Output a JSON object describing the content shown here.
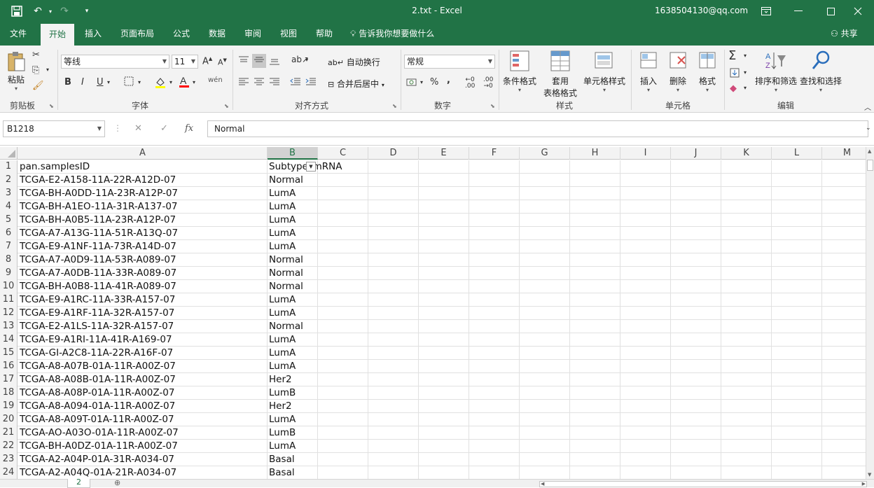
{
  "window": {
    "title": "2.txt  -  Excel",
    "user": "1638504130@qq.com"
  },
  "tabs": [
    "文件",
    "开始",
    "插入",
    "页面布局",
    "公式",
    "数据",
    "审阅",
    "视图",
    "帮助"
  ],
  "tellme": "告诉我你想要做什么",
  "share": "共享",
  "ribbon": {
    "clipboard": {
      "paste": "粘贴",
      "label": "剪贴板"
    },
    "font": {
      "name": "等线",
      "size": "11",
      "label": "字体",
      "bold": "B",
      "italic": "I",
      "underline": "U"
    },
    "alignment": {
      "wrap": "自动换行",
      "merge": "合并后居中",
      "label": "对齐方式"
    },
    "number": {
      "format": "常规",
      "label": "数字",
      "percent": "%",
      "comma": ","
    },
    "styles": {
      "conditional": "条件格式",
      "table_l1": "套用",
      "table_l2": "表格格式",
      "cell": "单元格样式",
      "label": "样式"
    },
    "cells": {
      "insert": "插入",
      "delete": "删除",
      "format": "格式",
      "label": "单元格"
    },
    "editing": {
      "sort": "排序和筛选",
      "find": "查找和选择",
      "label": "编辑"
    }
  },
  "formula_bar": {
    "name_box": "B1218",
    "value": "Normal"
  },
  "columns": [
    "A",
    "B",
    "C",
    "D",
    "E",
    "F",
    "G",
    "H",
    "I",
    "J",
    "K",
    "L",
    "M"
  ],
  "rows": [
    {
      "n": "1",
      "a": "pan.samplesID",
      "b": "Subtype_mRNA"
    },
    {
      "n": "2",
      "a": "TCGA-E2-A158-11A-22R-A12D-07",
      "b": "Normal"
    },
    {
      "n": "3",
      "a": "TCGA-BH-A0DD-11A-23R-A12P-07",
      "b": "LumA"
    },
    {
      "n": "4",
      "a": "TCGA-BH-A1EO-11A-31R-A137-07",
      "b": "LumA"
    },
    {
      "n": "5",
      "a": "TCGA-BH-A0B5-11A-23R-A12P-07",
      "b": "LumA"
    },
    {
      "n": "6",
      "a": "TCGA-A7-A13G-11A-51R-A13Q-07",
      "b": "LumA"
    },
    {
      "n": "7",
      "a": "TCGA-E9-A1NF-11A-73R-A14D-07",
      "b": "LumA"
    },
    {
      "n": "8",
      "a": "TCGA-A7-A0D9-11A-53R-A089-07",
      "b": "Normal"
    },
    {
      "n": "9",
      "a": "TCGA-A7-A0DB-11A-33R-A089-07",
      "b": "Normal"
    },
    {
      "n": "10",
      "a": "TCGA-BH-A0B8-11A-41R-A089-07",
      "b": "Normal"
    },
    {
      "n": "11",
      "a": "TCGA-E9-A1RC-11A-33R-A157-07",
      "b": "LumA"
    },
    {
      "n": "12",
      "a": "TCGA-E9-A1RF-11A-32R-A157-07",
      "b": "LumA"
    },
    {
      "n": "13",
      "a": "TCGA-E2-A1LS-11A-32R-A157-07",
      "b": "Normal"
    },
    {
      "n": "14",
      "a": "TCGA-E9-A1RI-11A-41R-A169-07",
      "b": "LumA"
    },
    {
      "n": "15",
      "a": "TCGA-GI-A2C8-11A-22R-A16F-07",
      "b": "LumA"
    },
    {
      "n": "16",
      "a": "TCGA-A8-A07B-01A-11R-A00Z-07",
      "b": "LumA"
    },
    {
      "n": "17",
      "a": "TCGA-A8-A08B-01A-11R-A00Z-07",
      "b": "Her2"
    },
    {
      "n": "18",
      "a": "TCGA-A8-A08P-01A-11R-A00Z-07",
      "b": "LumB"
    },
    {
      "n": "19",
      "a": "TCGA-A8-A094-01A-11R-A00Z-07",
      "b": "Her2"
    },
    {
      "n": "20",
      "a": "TCGA-A8-A09T-01A-11R-A00Z-07",
      "b": "LumA"
    },
    {
      "n": "21",
      "a": "TCGA-AO-A03O-01A-11R-A00Z-07",
      "b": "LumB"
    },
    {
      "n": "22",
      "a": "TCGA-BH-A0DZ-01A-11R-A00Z-07",
      "b": "LumA"
    },
    {
      "n": "23",
      "a": "TCGA-A2-A04P-01A-31R-A034-07",
      "b": "Basal"
    },
    {
      "n": "24",
      "a": "TCGA-A2-A04Q-01A-21R-A034-07",
      "b": "Basal"
    }
  ],
  "sheet_tab": "2",
  "add_sheet": "⊕"
}
